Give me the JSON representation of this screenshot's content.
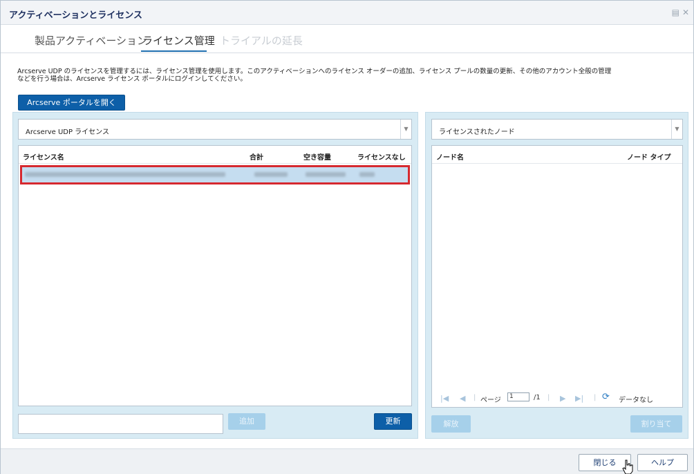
{
  "window": {
    "title": "アクティベーションとライセンス"
  },
  "tabs": [
    {
      "label": "製品アクティベーション",
      "state": "normal"
    },
    {
      "label": "ライセンス管理",
      "state": "active"
    },
    {
      "label": "トライアルの延長",
      "state": "disabled"
    }
  ],
  "description": {
    "line1": "Arcserve UDP のライセンスを管理するには、ライセンス管理を使用します。このアクティベーションへのライセンス オーダーの追加、ライセンス プールの数量の更新、その他のアカウント全般の管理",
    "line2": "などを行う場合は、Arcserve ライセンス ポータルにログインしてください。"
  },
  "portal_button": {
    "label": "Arcserve ポータルを開く"
  },
  "left_panel": {
    "combo_value": "Arcserve UDP ライセンス",
    "columns": [
      "ライセンス名",
      "合計",
      "空き容量",
      "ライセンスなし"
    ],
    "add_label": "追加",
    "refresh_label": "更新"
  },
  "right_panel": {
    "combo_value": "ライセンスされたノード",
    "columns": [
      "ノード名",
      "ノード タイプ"
    ],
    "pager": {
      "page_label": "ページ",
      "page_value": "1",
      "total": "/1",
      "status": "データなし"
    },
    "release_label": "解放",
    "assign_label": "割り当て"
  },
  "footer": {
    "close_label": "閉じる",
    "help_label": "ヘルプ"
  },
  "colors": {
    "accent": "#0d5fa8",
    "panel": "#d8ebf4",
    "selection_border": "#d6292f"
  }
}
